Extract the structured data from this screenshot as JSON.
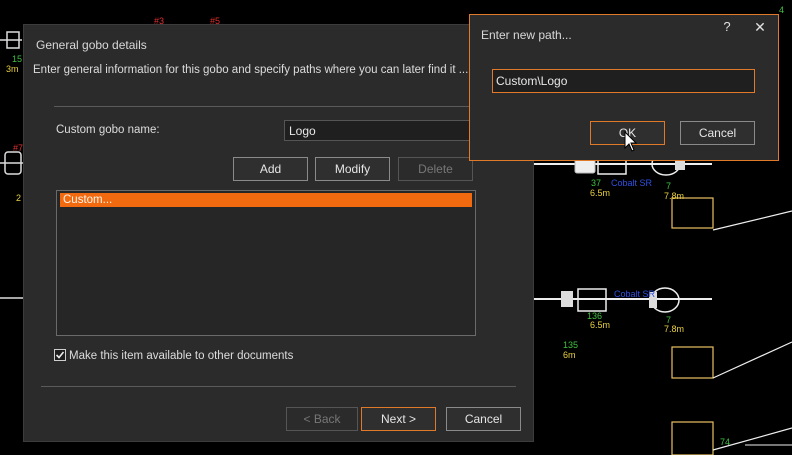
{
  "background_labels": {
    "red_top_1": "#3",
    "red_top_2": "#5",
    "green_15": "15",
    "yellow_3m": "3m",
    "red_left": "#7",
    "yellow_2": "2",
    "green_37": "37",
    "blue_upper": "Cobalt SR",
    "yellow_65m_upper": "6.5m",
    "green_7_upper": "7",
    "yellow_78m_upper": "7.8m",
    "blue_lower": "Cobalt SR",
    "green_136": "136",
    "yellow_65m_lower": "6.5m",
    "green_7_lower": "7",
    "yellow_78m_lower": "7.8m",
    "green_135": "135",
    "yellow_6m": "6m",
    "green_74": "74",
    "green_top_right": "4"
  },
  "main_dialog": {
    "title": "General gobo details",
    "intro": "Enter general information for this gobo and specify paths where you can later find it ...",
    "name_label": "Custom gobo name:",
    "name_value": "Logo",
    "add_label": "Add",
    "modify_label": "Modify",
    "delete_label": "Delete",
    "paths": [
      "Custom..."
    ],
    "checkbox_label": "Make this item available to other documents",
    "checkbox_checked": true,
    "back_label": "< Back",
    "next_label": "Next >",
    "cancel_label": "Cancel"
  },
  "path_dialog": {
    "title": "Enter new path...",
    "help": "?",
    "close": "✕",
    "path_value": "Custom\\Logo",
    "ok_label": "OK",
    "cancel_label": "Cancel"
  },
  "colors": {
    "accent": "#f26a10",
    "dialog_bg": "#2b2b2b",
    "cad_bg": "#000000"
  }
}
